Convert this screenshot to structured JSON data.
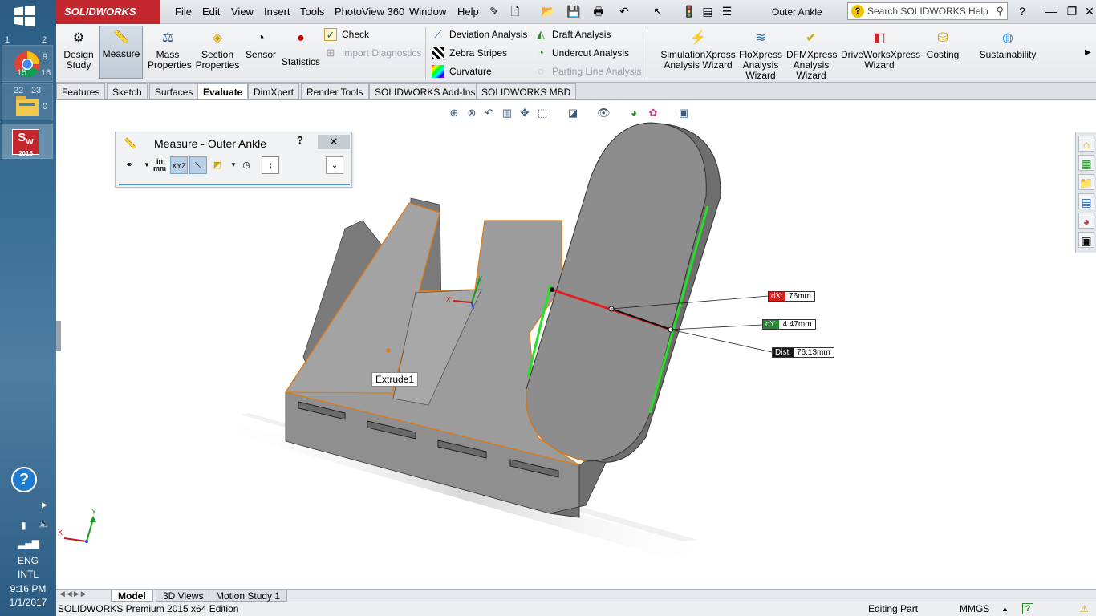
{
  "app": {
    "brand": "SOLIDWORKS",
    "menus": [
      "File",
      "Edit",
      "View",
      "Insert",
      "Tools",
      "PhotoView 360",
      "Window",
      "Help"
    ],
    "document_title": "Outer Ankle",
    "search_placeholder": "Search SOLIDWORKS Help"
  },
  "taskbar": {
    "apps": [
      "chrome-icon",
      "file-explorer-icon",
      "solidworks-2015-icon"
    ],
    "sw_badge": "2015",
    "help_icon": "help-icon",
    "language": "ENG",
    "layout": "INTL",
    "time": "9:16 PM",
    "date": "1/1/2017",
    "tile_numbers": [
      "1",
      "2",
      "9",
      "16",
      "15",
      "22",
      "23",
      "0"
    ]
  },
  "ribbon": {
    "design_study": "Design Study",
    "measure": "Measure",
    "mass_properties": "Mass Properties",
    "section_properties": "Section Properties",
    "sensor": "Sensor",
    "statistics": "Statistics",
    "check": "Check",
    "import_diagnostics": "Import Diagnostics",
    "deviation_analysis": "Deviation Analysis",
    "zebra_stripes": "Zebra Stripes",
    "curvature": "Curvature",
    "draft_analysis": "Draft Analysis",
    "undercut_analysis": "Undercut Analysis",
    "parting_line_analysis": "Parting Line Analysis",
    "simulationxpress": "SimulationXpress Analysis Wizard",
    "floxpress": "FloXpress Analysis Wizard",
    "dfmxpress": "DFMXpress Analysis Wizard",
    "driveworksxpress": "DriveWorksXpress Wizard",
    "costing": "Costing",
    "sustainability": "Sustainability"
  },
  "tabs": [
    "Features",
    "Sketch",
    "Surfaces",
    "Evaluate",
    "DimXpert",
    "Render Tools",
    "SOLIDWORKS Add-Ins",
    "SOLIDWORKS MBD"
  ],
  "active_tab": "Evaluate",
  "measure_dialog": {
    "title": "Measure - Outer Ankle",
    "help": "?",
    "close": "✕",
    "unit_label_top": "in",
    "unit_label_bottom": "mm",
    "xyz_label": "XYZ"
  },
  "measurements": {
    "dx_label": "dX:",
    "dx_value": "76mm",
    "dy_label": "dY:",
    "dy_value": "4.47mm",
    "dist_label": "Dist:",
    "dist_value": "76.13mm"
  },
  "tooltip": "Extrude1",
  "axes": {
    "x": "X",
    "y": "Y"
  },
  "bottom_tabs": [
    "Model",
    "3D Views",
    "Motion Study 1"
  ],
  "active_bottom_tab": "Model",
  "status": {
    "edition": "SOLIDWORKS Premium 2015 x64 Edition",
    "mode": "Editing Part",
    "units": "MMGS"
  },
  "colors": {
    "sw_red": "#c4262e",
    "dx_tag": "#d81f1f",
    "dy_tag": "#1f8a2e",
    "dist_tag": "#1a1a1a",
    "model_gray": "#8c8c8c",
    "edge_orange": "#e07a12",
    "highlight_green": "#25e025"
  }
}
